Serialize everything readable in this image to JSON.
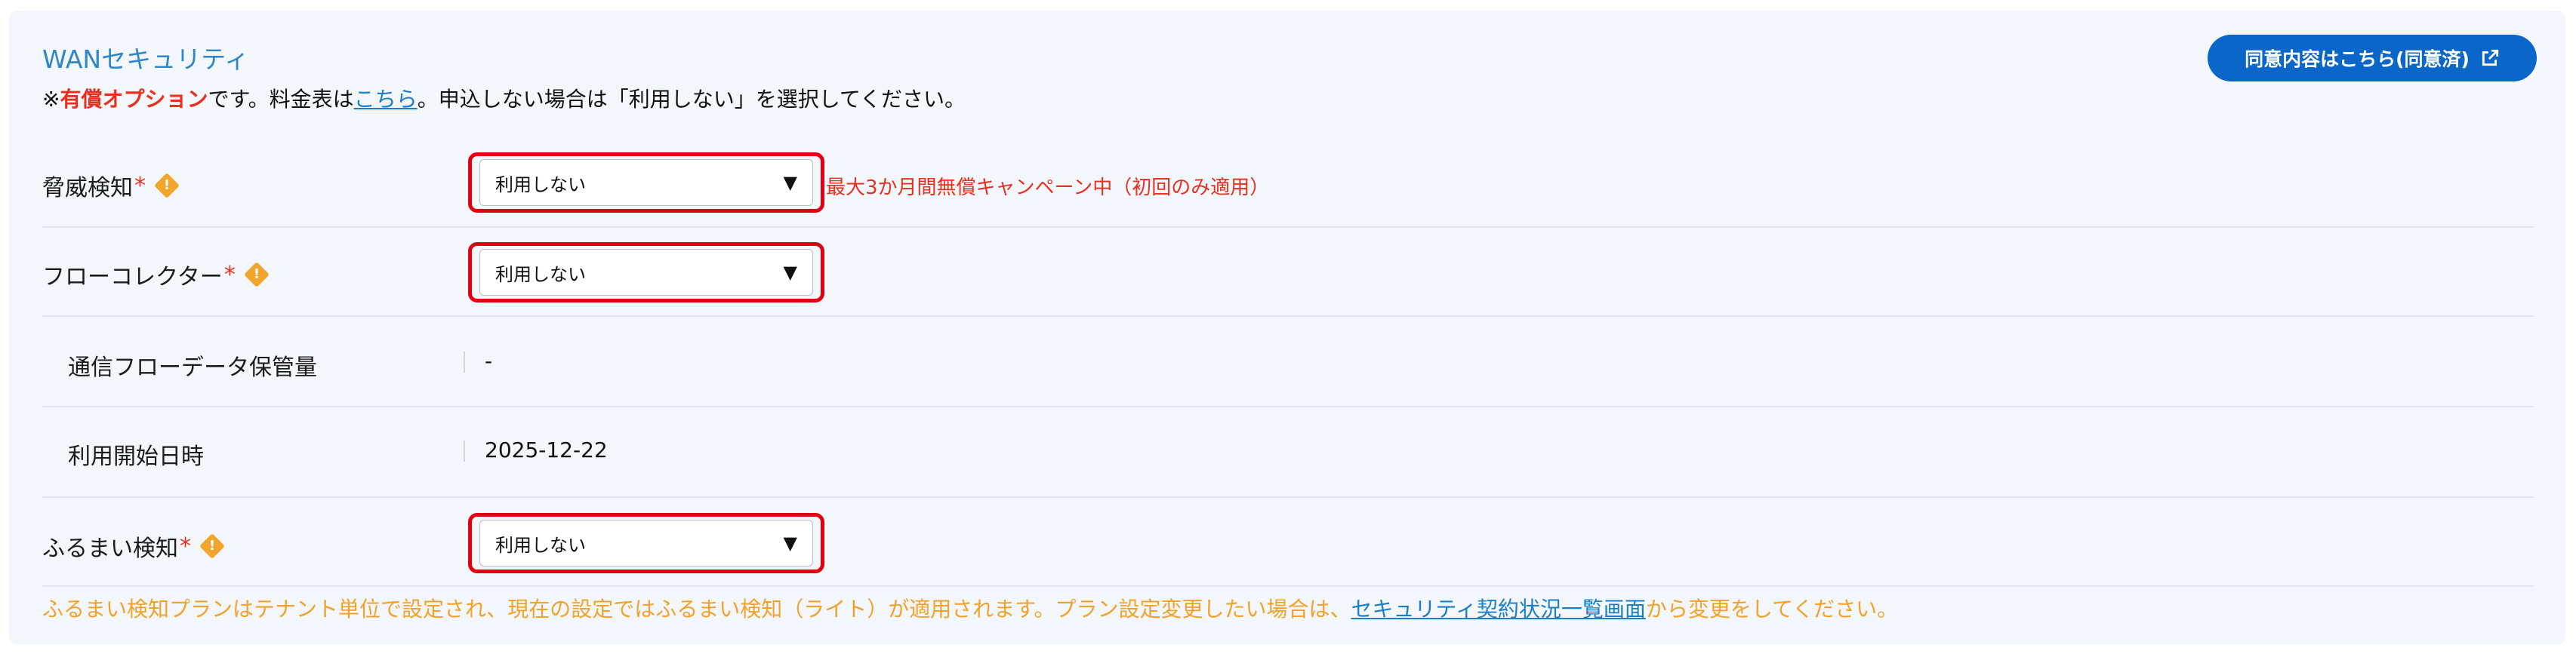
{
  "section": {
    "title": "WANセキュリティ",
    "consent_button": "同意内容はこちら(同意済)",
    "notice": {
      "prefix": "※",
      "paid": "有償オプション",
      "mid": "です。料金表は",
      "link": "こちら",
      "suffix": "。申込しない場合は「利用しない」を選択してください。"
    }
  },
  "rows": {
    "threat": {
      "label": "脅威検知",
      "required": "*",
      "value": "利用しない",
      "campaign": "最大3か月間無償キャンペーン中（初回のみ適用）"
    },
    "flow": {
      "label": "フローコレクター",
      "required": "*",
      "value": "利用しない"
    },
    "flow_storage": {
      "label": "通信フローデータ保管量",
      "value": "-"
    },
    "start_date": {
      "label": "利用開始日時",
      "value": "2025-12-22"
    },
    "behavior": {
      "label": "ふるまい検知",
      "required": "*",
      "value": "利用しない"
    }
  },
  "footnote": {
    "text": "ふるまい検知プランはテナント単位で設定され、現在の設定ではふるまい検知（ライト）が適用されます。プラン設定変更したい場合は、",
    "link": "セキュリティ契約状況一覧画面",
    "suffix": "から変更をしてください。"
  },
  "icons": {
    "info": "warning-diamond-icon",
    "external": "external-link-icon",
    "caret": "caret-down-icon"
  },
  "colors": {
    "accent": "#0b66c9",
    "required": "#e8301f",
    "highlight": "#e00012",
    "warning": "#f1a62b"
  }
}
